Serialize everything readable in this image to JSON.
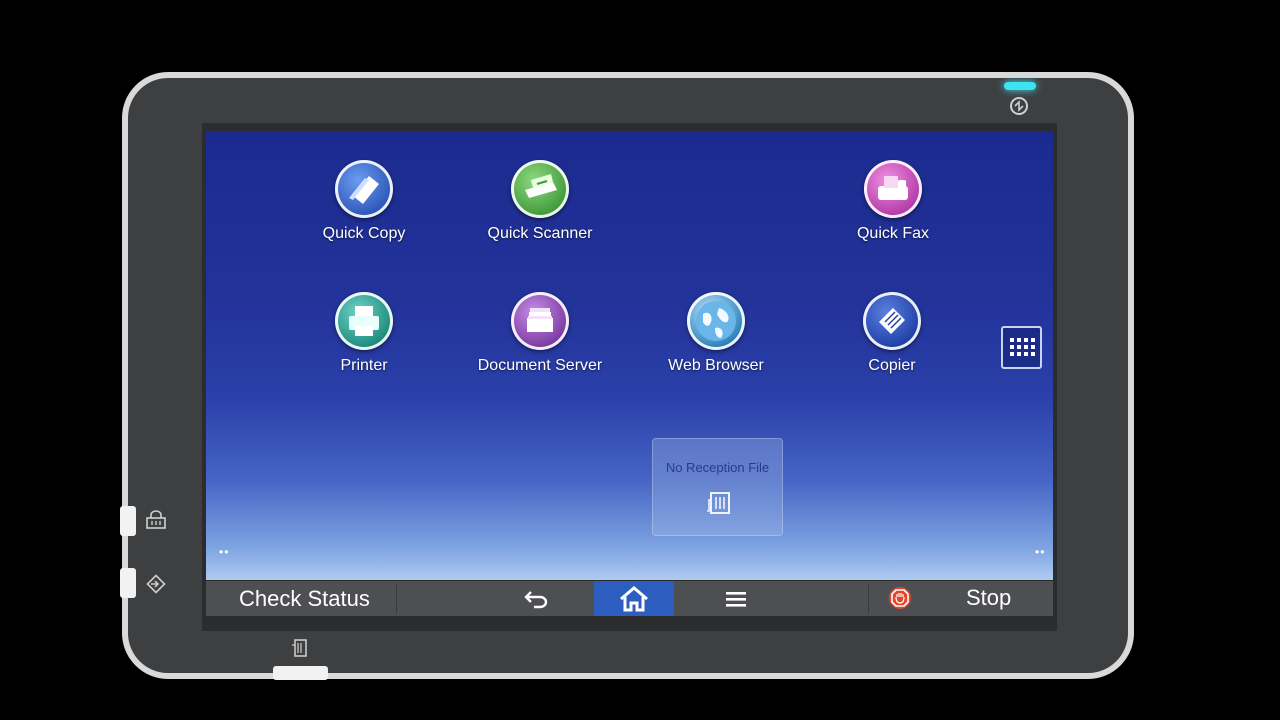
{
  "apps": [
    {
      "id": "quick-copy",
      "label": "Quick Copy",
      "icon": "quick-copy-icon",
      "color": "#2d57b8"
    },
    {
      "id": "quick-scanner",
      "label": "Quick Scanner",
      "icon": "quick-scanner-icon",
      "color": "#3f9b3a"
    },
    {
      "id": "quick-fax",
      "label": "Quick Fax",
      "icon": "quick-fax-icon",
      "color": "#b23aa8"
    },
    {
      "id": "printer",
      "label": "Printer",
      "icon": "printer-icon",
      "color": "#1e8a7e"
    },
    {
      "id": "document-server",
      "label": "Document Server",
      "icon": "document-server-icon",
      "color": "#7b3aa0"
    },
    {
      "id": "web-browser",
      "label": "Web Browser",
      "icon": "web-browser-icon",
      "color": "#2a7fb8"
    },
    {
      "id": "copier",
      "label": "Copier",
      "icon": "copier-icon",
      "color": "#1f3fa6"
    }
  ],
  "widget": {
    "title": "No Reception File",
    "icon": "fax-tray-icon"
  },
  "bottom_bar": {
    "check_status": "Check Status",
    "back_icon": "back-arrow-icon",
    "home_icon": "home-icon",
    "menu_icon": "menu-icon",
    "stop_label": "Stop",
    "stop_icon": "stop-icon"
  },
  "colors": {
    "home_active": "#2e5dc0",
    "screen_top": "#1b2a8e",
    "screen_bottom": "#e4f1fb",
    "led": "#3de3f0"
  }
}
